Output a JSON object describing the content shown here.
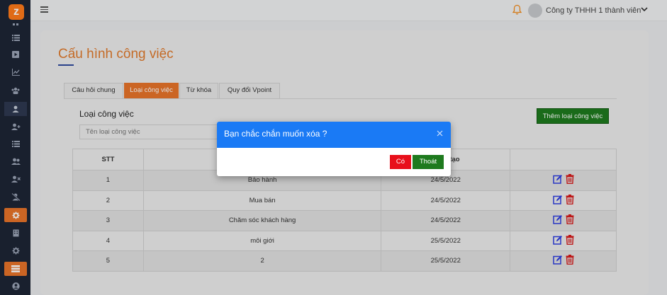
{
  "app": {
    "logo_letter": "z"
  },
  "sidebar": {
    "items": [
      {
        "icon": "grid-icon"
      },
      {
        "icon": "list-icon"
      },
      {
        "icon": "play-icon"
      },
      {
        "icon": "chart-icon"
      },
      {
        "icon": "people-icon"
      },
      {
        "icon": "user-icon"
      },
      {
        "icon": "user-plus-icon"
      },
      {
        "icon": "list-icon"
      },
      {
        "icon": "users-icon"
      },
      {
        "icon": "user-x-icon"
      },
      {
        "icon": "user-slash-icon"
      },
      {
        "icon": "gear-icon"
      },
      {
        "icon": "building-icon"
      },
      {
        "icon": "settings-icon"
      },
      {
        "icon": "server-icon"
      },
      {
        "icon": "account-icon"
      }
    ]
  },
  "header": {
    "company": "Công ty THHH 1 thành viên"
  },
  "page": {
    "title": "Cấu hình công việc",
    "tabs": [
      "Câu hỏi chung",
      "Loại công việc",
      "Từ khóa",
      "Quy đổi Vpoint"
    ],
    "active_tab": 1,
    "section_title": "Loại công việc",
    "search_placeholder": "Tên loại công việc",
    "add_button": "Thêm loại công việc"
  },
  "table": {
    "headers": [
      "STT",
      "",
      "tạo",
      ""
    ],
    "rows": [
      {
        "stt": "1",
        "name": "Bảo hành",
        "date": "24/5/2022"
      },
      {
        "stt": "2",
        "name": "Mua bán",
        "date": "24/5/2022"
      },
      {
        "stt": "3",
        "name": "Chăm sóc khách hàng",
        "date": "24/5/2022"
      },
      {
        "stt": "4",
        "name": "môi giới",
        "date": "25/5/2022"
      },
      {
        "stt": "5",
        "name": "2",
        "date": "25/5/2022"
      }
    ]
  },
  "modal": {
    "title": "Bạn chắc chắn muốn xóa ?",
    "yes": "Có",
    "exit": "Thoát"
  },
  "colors": {
    "accent": "#e8732a",
    "primary": "#1a7af5",
    "success": "#1e7a1e",
    "danger": "#e8101b",
    "sidebar": "#1d2535"
  }
}
